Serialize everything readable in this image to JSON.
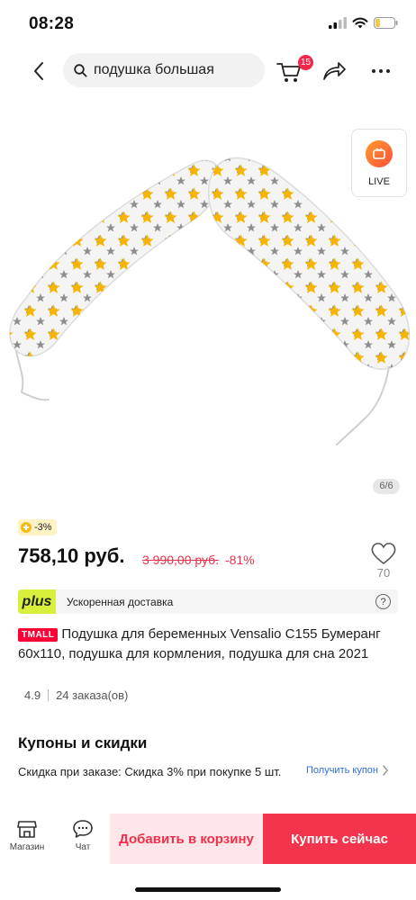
{
  "status_bar": {
    "time": "08:28",
    "icons": [
      "signal-icon",
      "wifi-icon",
      "battery-icon"
    ],
    "battery_color": "#f2c94c"
  },
  "nav": {
    "back_icon": "chevron-left-icon",
    "search_icon": "search-icon",
    "search_placeholder": "подушка большая",
    "cart_icon": "cart-icon",
    "cart_badge": "15",
    "share_icon": "share-icon",
    "more_icon": "more-dots-icon"
  },
  "gallery": {
    "live_label": "LIVE",
    "counter": "6/6"
  },
  "price_block": {
    "chip_label": "-3%",
    "price": "758,10 руб.",
    "old_price": "3 990,00 руб.",
    "discount": "-81%",
    "wish_count": "70"
  },
  "delivery": {
    "plus_logo": "plus",
    "text": "Ускоренная доставка",
    "help": "?"
  },
  "product": {
    "badge": "TMALL",
    "title": "Подушка для беременных Vensalio C155 Бумеранг 60х110, подушка для кормления, подушка для сна 2021",
    "rating_stars": 5,
    "rating": "4.9",
    "orders": "24 заказа(ов)"
  },
  "coupons": {
    "title": "Купоны и скидки",
    "text": "Скидка при заказе: Скидка 3% при покупке 5 шт.",
    "link": "Получить купон"
  },
  "bottom_bar": {
    "store_label": "Магазин",
    "chat_label": "Чат",
    "add_to_cart": "Добавить в корзину",
    "buy_now": "Купить сейчас"
  },
  "colors": {
    "accent_red": "#f2344c",
    "star_yellow": "#f7b500",
    "plus_green": "#d8f03c",
    "link_blue": "#2f6fd6"
  }
}
